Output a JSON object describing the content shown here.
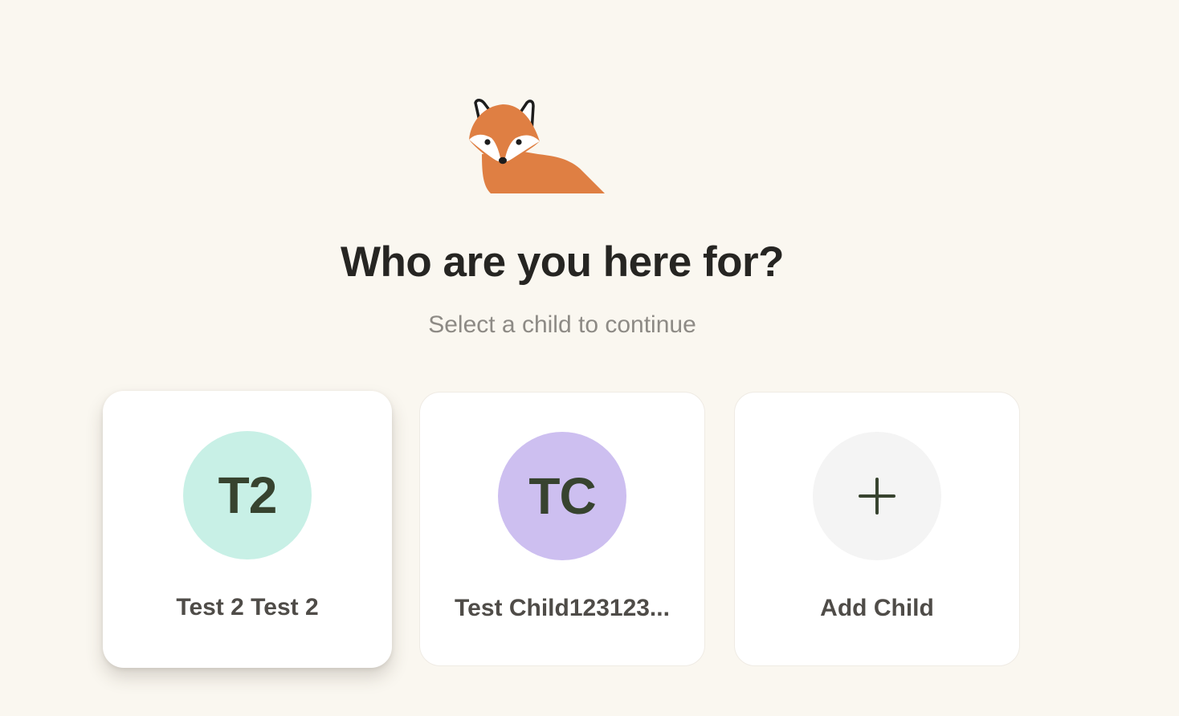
{
  "header": {
    "mascot_icon": "fox-icon",
    "title": "Who are you here for?",
    "subtitle": "Select a child to continue"
  },
  "children": [
    {
      "initials": "T2",
      "name": "Test 2 Test 2",
      "avatar_color": "#c8f0e6",
      "selected": true
    },
    {
      "initials": "TC",
      "name": "Test Child123123...",
      "avatar_color": "#cdbff0",
      "selected": false
    }
  ],
  "add_child": {
    "label": "Add Child",
    "icon": "plus-icon",
    "avatar_color": "#f4f4f4"
  },
  "colors": {
    "background": "#faf7f0",
    "fox": "#df7f43",
    "initials_text": "#37432f",
    "title_text": "#262522",
    "subtitle_text": "#8d8a85"
  }
}
